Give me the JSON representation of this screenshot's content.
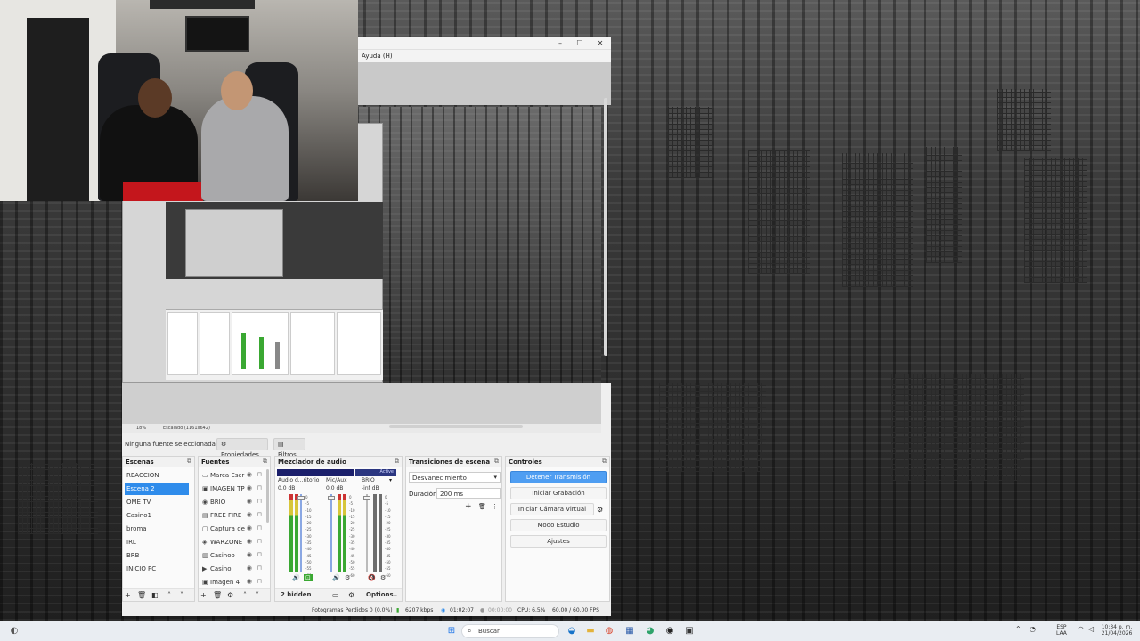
{
  "obs": {
    "menu_help": "Ayuda (H)",
    "window_min": "–",
    "window_max": "☐",
    "window_close": "✕",
    "preview_zoom": "18%",
    "preview_scale": "Escalado (1161x642)",
    "no_source": "Ninguna fuente seleccionada",
    "properties_label": "Propiedades",
    "filters_label": "Filtros"
  },
  "scenes": {
    "title": "Escenas",
    "items": [
      "REACCION",
      "Escena 2",
      "OME TV",
      "Casino1",
      "broma",
      "IRL",
      "BRB",
      "INICIO PC"
    ],
    "selected_index": 1
  },
  "sources": {
    "title": "Fuentes",
    "items": [
      {
        "label": "Marca Escr",
        "icon": "text-icon",
        "glyph": "▭"
      },
      {
        "label": "IMAGEN TP",
        "icon": "image-icon",
        "glyph": "▣"
      },
      {
        "label": "BRIO",
        "icon": "camera-icon",
        "glyph": "◉"
      },
      {
        "label": "FREE FIRE",
        "icon": "window-capture-icon",
        "glyph": "▤"
      },
      {
        "label": "Captura de",
        "icon": "display-capture-icon",
        "glyph": "▢"
      },
      {
        "label": "WARZONE",
        "icon": "game-capture-icon",
        "glyph": "◈"
      },
      {
        "label": "Casinoo",
        "icon": "browser-icon",
        "glyph": "▥"
      },
      {
        "label": "Casino",
        "icon": "media-icon",
        "glyph": "▶"
      },
      {
        "label": "Imagen 4",
        "icon": "image-icon",
        "glyph": "▣"
      }
    ]
  },
  "mixer": {
    "title": "Mezclador de audio",
    "active_label": "Active",
    "channels": [
      {
        "name": "Audio d...ritorio",
        "db": "0.0 dB",
        "muted": false
      },
      {
        "name": "Mic/Aux",
        "db": "0.0 dB",
        "muted": false
      },
      {
        "name": "BRIO",
        "db": "-inf dB",
        "muted": true
      }
    ],
    "tick_labels": [
      "0",
      "-5",
      "-10",
      "-15",
      "-20",
      "-25",
      "-30",
      "-35",
      "-40",
      "-45",
      "-50",
      "-55",
      "-60"
    ],
    "hidden_label": "2 hidden",
    "options_label": "Options"
  },
  "transitions": {
    "title": "Transiciones de escena",
    "selected": "Desvanecimiento",
    "duration_label": "Duración",
    "duration_value": "200 ms"
  },
  "controls": {
    "title": "Controles",
    "buttons": [
      "Detener Transmisión",
      "Iniciar Grabación",
      "Iniciar Cámara Virtual",
      "Modo Estudio",
      "Ajustes"
    ]
  },
  "status": {
    "dropped_frames": "Fotogramas Perdidos 0 (0.0%)",
    "bitrate": "6207 kbps",
    "stream_time": "01:02:07",
    "rec_time": "00:00:00",
    "cpu": "CPU: 6.5%",
    "fps": "60.00 / 60.00 FPS"
  },
  "taskbar": {
    "search_placeholder": "Buscar",
    "lang_top": "ESP",
    "lang_bottom": "LAA",
    "time": "10:34 p. m.",
    "date": "21/04/2026"
  },
  "colors": {
    "accent": "#2f8ceb",
    "stream_button": "#4f9ef2",
    "mixer_header": "#1b1f6b",
    "meter_green": "#3aa832"
  }
}
